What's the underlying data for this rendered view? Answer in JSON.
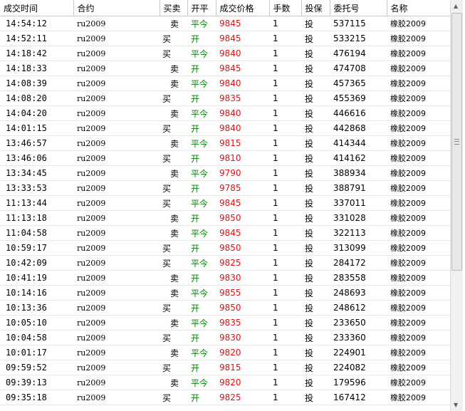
{
  "headers": [
    "成交时间",
    "合约",
    "买卖",
    "开平",
    "成交价格",
    "手数",
    "投保",
    "委托号",
    "名称"
  ],
  "rows": [
    {
      "time": "14:54:12",
      "contract": "ru2009",
      "side": "卖",
      "oc": "平今",
      "price": "9845",
      "qty": "1",
      "hedge": "投",
      "order_id": "537115",
      "name": "橡胶2009"
    },
    {
      "time": "14:52:11",
      "contract": "ru2009",
      "side": "买",
      "oc": "开",
      "price": "9845",
      "qty": "1",
      "hedge": "投",
      "order_id": "533215",
      "name": "橡胶2009"
    },
    {
      "time": "14:18:42",
      "contract": "ru2009",
      "side": "买",
      "oc": "平今",
      "price": "9840",
      "qty": "1",
      "hedge": "投",
      "order_id": "476194",
      "name": "橡胶2009"
    },
    {
      "time": "14:18:33",
      "contract": "ru2009",
      "side": "卖",
      "oc": "开",
      "price": "9845",
      "qty": "1",
      "hedge": "投",
      "order_id": "474708",
      "name": "橡胶2009"
    },
    {
      "time": "14:08:39",
      "contract": "ru2009",
      "side": "卖",
      "oc": "平今",
      "price": "9840",
      "qty": "1",
      "hedge": "投",
      "order_id": "457365",
      "name": "橡胶2009"
    },
    {
      "time": "14:08:20",
      "contract": "ru2009",
      "side": "买",
      "oc": "开",
      "price": "9835",
      "qty": "1",
      "hedge": "投",
      "order_id": "455369",
      "name": "橡胶2009"
    },
    {
      "time": "14:04:20",
      "contract": "ru2009",
      "side": "卖",
      "oc": "平今",
      "price": "9840",
      "qty": "1",
      "hedge": "投",
      "order_id": "446616",
      "name": "橡胶2009"
    },
    {
      "time": "14:01:15",
      "contract": "ru2009",
      "side": "买",
      "oc": "开",
      "price": "9840",
      "qty": "1",
      "hedge": "投",
      "order_id": "442868",
      "name": "橡胶2009"
    },
    {
      "time": "13:46:57",
      "contract": "ru2009",
      "side": "卖",
      "oc": "平今",
      "price": "9815",
      "qty": "1",
      "hedge": "投",
      "order_id": "414344",
      "name": "橡胶2009"
    },
    {
      "time": "13:46:06",
      "contract": "ru2009",
      "side": "买",
      "oc": "开",
      "price": "9810",
      "qty": "1",
      "hedge": "投",
      "order_id": "414162",
      "name": "橡胶2009"
    },
    {
      "time": "13:34:45",
      "contract": "ru2009",
      "side": "卖",
      "oc": "平今",
      "price": "9790",
      "qty": "1",
      "hedge": "投",
      "order_id": "388934",
      "name": "橡胶2009"
    },
    {
      "time": "13:33:53",
      "contract": "ru2009",
      "side": "买",
      "oc": "开",
      "price": "9785",
      "qty": "1",
      "hedge": "投",
      "order_id": "388791",
      "name": "橡胶2009"
    },
    {
      "time": "11:13:44",
      "contract": "ru2009",
      "side": "买",
      "oc": "平今",
      "price": "9845",
      "qty": "1",
      "hedge": "投",
      "order_id": "337011",
      "name": "橡胶2009"
    },
    {
      "time": "11:13:18",
      "contract": "ru2009",
      "side": "卖",
      "oc": "开",
      "price": "9850",
      "qty": "1",
      "hedge": "投",
      "order_id": "331028",
      "name": "橡胶2009"
    },
    {
      "time": "11:04:58",
      "contract": "ru2009",
      "side": "卖",
      "oc": "平今",
      "price": "9845",
      "qty": "1",
      "hedge": "投",
      "order_id": "322113",
      "name": "橡胶2009"
    },
    {
      "time": "10:59:17",
      "contract": "ru2009",
      "side": "买",
      "oc": "开",
      "price": "9850",
      "qty": "1",
      "hedge": "投",
      "order_id": "313099",
      "name": "橡胶2009"
    },
    {
      "time": "10:42:09",
      "contract": "ru2009",
      "side": "买",
      "oc": "平今",
      "price": "9825",
      "qty": "1",
      "hedge": "投",
      "order_id": "284172",
      "name": "橡胶2009"
    },
    {
      "time": "10:41:19",
      "contract": "ru2009",
      "side": "卖",
      "oc": "开",
      "price": "9830",
      "qty": "1",
      "hedge": "投",
      "order_id": "283558",
      "name": "橡胶2009"
    },
    {
      "time": "10:14:16",
      "contract": "ru2009",
      "side": "卖",
      "oc": "平今",
      "price": "9855",
      "qty": "1",
      "hedge": "投",
      "order_id": "248693",
      "name": "橡胶2009"
    },
    {
      "time": "10:13:36",
      "contract": "ru2009",
      "side": "买",
      "oc": "开",
      "price": "9850",
      "qty": "1",
      "hedge": "投",
      "order_id": "248612",
      "name": "橡胶2009"
    },
    {
      "time": "10:05:10",
      "contract": "ru2009",
      "side": "卖",
      "oc": "平今",
      "price": "9835",
      "qty": "1",
      "hedge": "投",
      "order_id": "233650",
      "name": "橡胶2009"
    },
    {
      "time": "10:04:58",
      "contract": "ru2009",
      "side": "买",
      "oc": "开",
      "price": "9830",
      "qty": "1",
      "hedge": "投",
      "order_id": "233360",
      "name": "橡胶2009"
    },
    {
      "time": "10:01:17",
      "contract": "ru2009",
      "side": "卖",
      "oc": "平今",
      "price": "9820",
      "qty": "1",
      "hedge": "投",
      "order_id": "224901",
      "name": "橡胶2009"
    },
    {
      "time": "09:59:52",
      "contract": "ru2009",
      "side": "买",
      "oc": "开",
      "price": "9815",
      "qty": "1",
      "hedge": "投",
      "order_id": "224082",
      "name": "橡胶2009"
    },
    {
      "time": "09:39:13",
      "contract": "ru2009",
      "side": "卖",
      "oc": "平今",
      "price": "9820",
      "qty": "1",
      "hedge": "投",
      "order_id": "179596",
      "name": "橡胶2009"
    },
    {
      "time": "09:35:18",
      "contract": "ru2009",
      "side": "买",
      "oc": "开",
      "price": "9825",
      "qty": "1",
      "hedge": "投",
      "order_id": "167412",
      "name": "橡胶2009"
    }
  ],
  "colors": {
    "price": "#dd1111",
    "open_close": "#0a7a0a",
    "grid_line": "#c8c8c8"
  },
  "scrollbar": {
    "up_icon": "triangle-up",
    "down_icon": "triangle-down"
  }
}
